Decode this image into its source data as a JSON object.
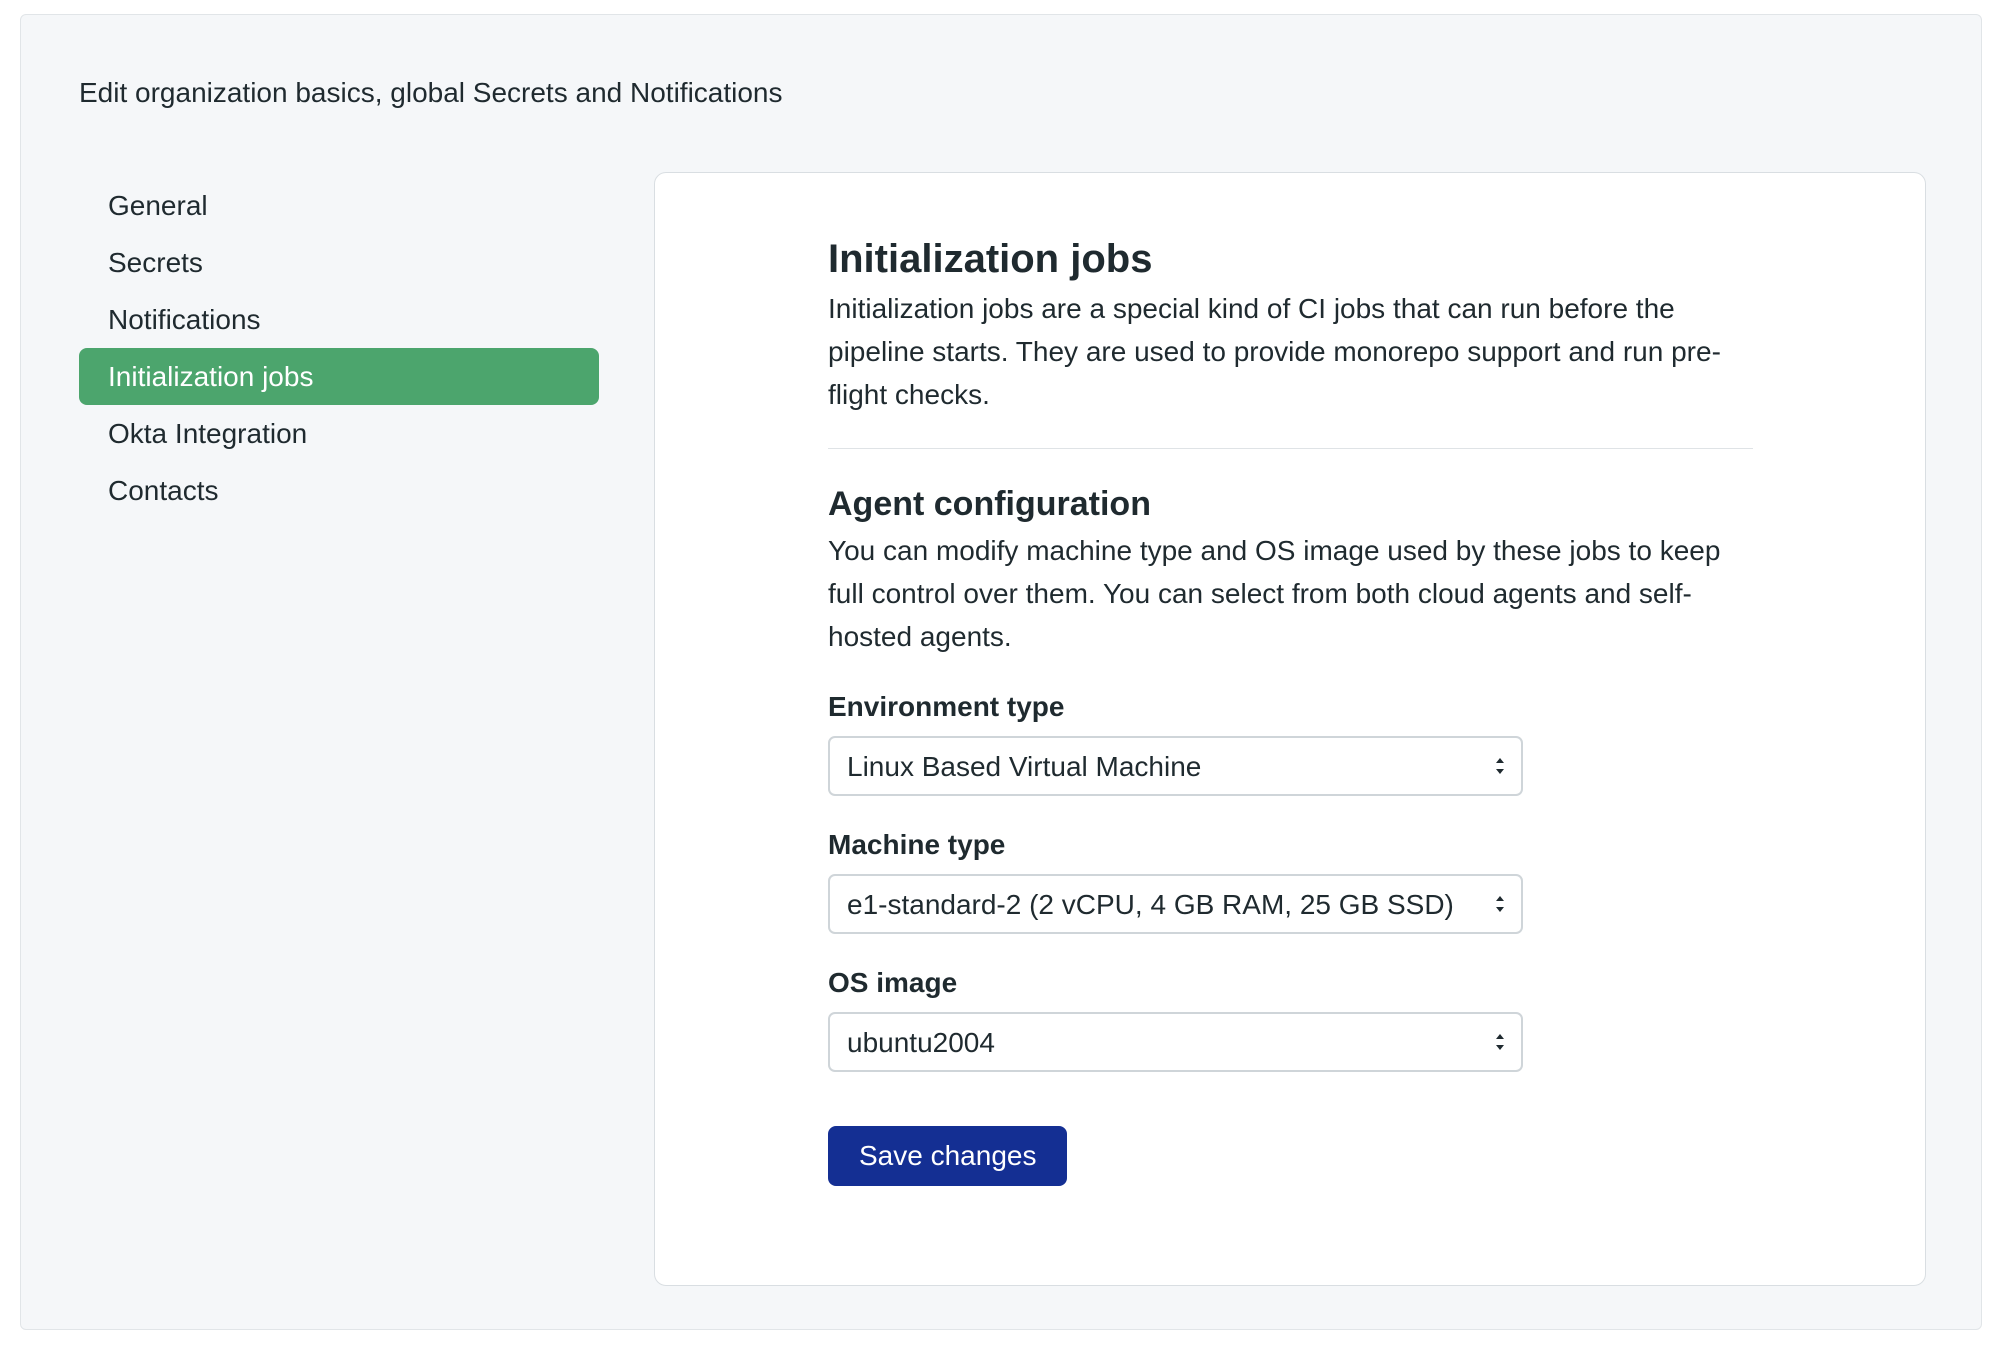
{
  "header": {
    "description": "Edit organization basics, global Secrets and Notifications"
  },
  "sidebar": {
    "items": [
      {
        "label": "General"
      },
      {
        "label": "Secrets"
      },
      {
        "label": "Notifications"
      },
      {
        "label": "Initialization jobs",
        "active": true
      },
      {
        "label": "Okta Integration"
      },
      {
        "label": "Contacts"
      }
    ]
  },
  "main": {
    "title": "Initialization jobs",
    "intro": "Initialization jobs are a special kind of CI jobs that can run before the pipeline starts. They are used to provide monorepo support and run pre-flight checks.",
    "agent_section": {
      "title": "Agent configuration",
      "description": "You can modify machine type and OS image used by these jobs to keep full control over them. You can select from both cloud agents and self-hosted agents."
    },
    "fields": {
      "environment_type": {
        "label": "Environment type",
        "value": "Linux Based Virtual Machine"
      },
      "machine_type": {
        "label": "Machine type",
        "value": "e1-standard-2 (2 vCPU, 4 GB RAM, 25 GB SSD)"
      },
      "os_image": {
        "label": "OS image",
        "value": "ubuntu2004"
      }
    },
    "save_label": "Save changes"
  },
  "colors": {
    "active_nav": "#4ca56d",
    "primary_button": "#142f93",
    "page_background": "#f5f7f9"
  }
}
